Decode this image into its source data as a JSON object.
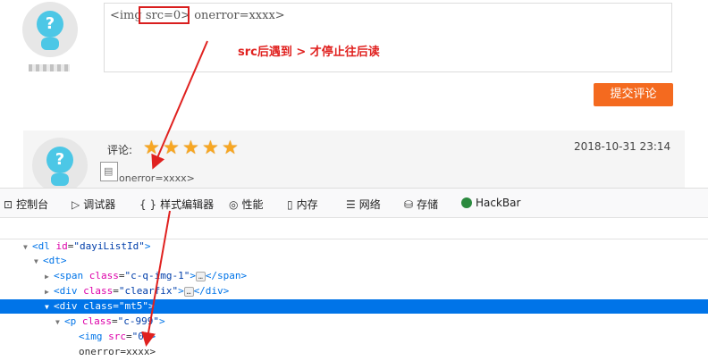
{
  "comment": {
    "text": "<img src=0> onerror=xxxx>",
    "part_before": "<img ",
    "part_highlight": "src=0>",
    "part_after": " onerror=xxxx>",
    "annotation": "src后遇到 > 才停止往后读",
    "username": " "
  },
  "submit": {
    "label": "提交评论"
  },
  "review": {
    "rating_label": "评论:",
    "stars": "★★★★★",
    "date": "2018-10-31 23:14",
    "broken_text": "onerror=xxxx>"
  },
  "devtools": {
    "tabs": [
      {
        "icon": "⊡",
        "label": "控制台"
      },
      {
        "icon": "▷",
        "label": "调试器"
      },
      {
        "icon": "{ }",
        "label": "样式编辑器"
      },
      {
        "icon": "◎",
        "label": "性能"
      },
      {
        "icon": "▯",
        "label": "内存"
      },
      {
        "icon": "☰",
        "label": "网络"
      },
      {
        "icon": "⛁",
        "label": "存储"
      },
      {
        "icon": "",
        "label": "HackBar"
      }
    ],
    "tree": {
      "dl_tag": "dl",
      "dl_attr": "id",
      "dl_val": "\"dayiListId\"",
      "dt_tag": "dt",
      "span_attr": "class",
      "span_val": "\"c-q-img-1\"",
      "span_tag": "span",
      "div1_val": "\"clearfix\"",
      "div2_val": "\"mt5\"",
      "p_val": "\"c-999\"",
      "img_attr": "src",
      "img_val": "\"0\"",
      "onerror_text": "onerror=xxxx>"
    }
  },
  "colors": {
    "accent": "#f46a1f",
    "selection": "#0074e8",
    "annotation": "#e0211f"
  }
}
